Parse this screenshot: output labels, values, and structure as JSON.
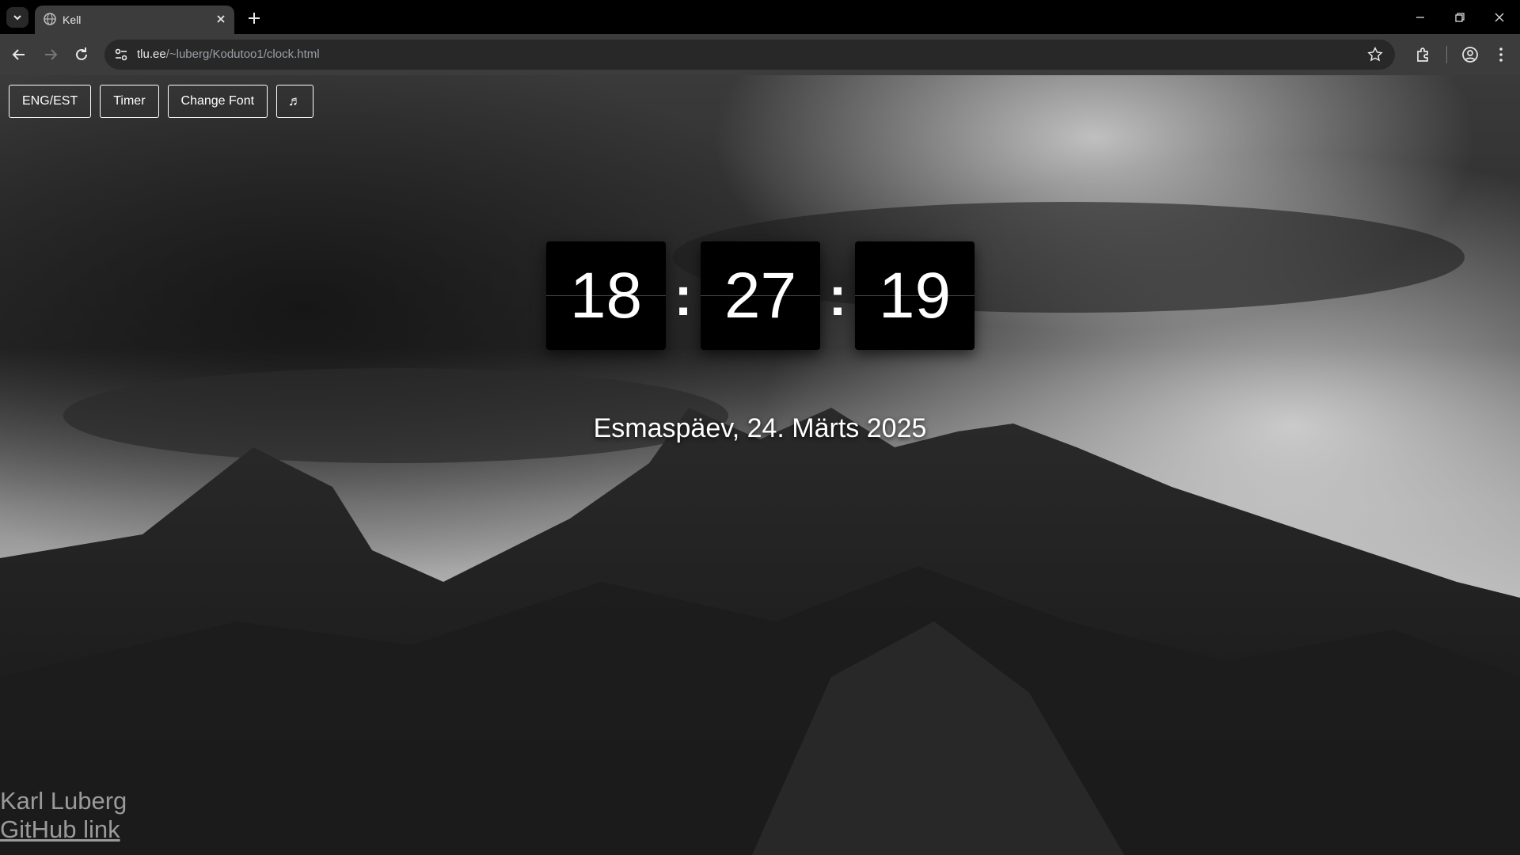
{
  "browser": {
    "tab_title": "Kell",
    "url_host": "tlu.ee",
    "url_path": "/~luberg/Kodutoo1/clock.html"
  },
  "buttons": {
    "lang": "ENG/EST",
    "timer": "Timer",
    "font": "Change Font",
    "music": "♬"
  },
  "clock": {
    "hours": "18",
    "minutes": "27",
    "seconds": "19",
    "separator": ":"
  },
  "date_text": "Esmaspäev, 24. Märts 2025",
  "footer": {
    "author": "Karl Luberg",
    "link": "GitHub link"
  },
  "icons": {
    "tab_list": "chevron-down-icon",
    "favicon": "globe-icon",
    "close": "close-icon",
    "new_tab": "plus-icon",
    "back": "back-arrow-icon",
    "forward": "forward-arrow-icon",
    "reload": "reload-icon",
    "site_info": "tune-icon",
    "bookmark": "star-icon",
    "extensions": "puzzle-icon",
    "profile": "profile-icon",
    "menu": "kebab-menu-icon"
  }
}
